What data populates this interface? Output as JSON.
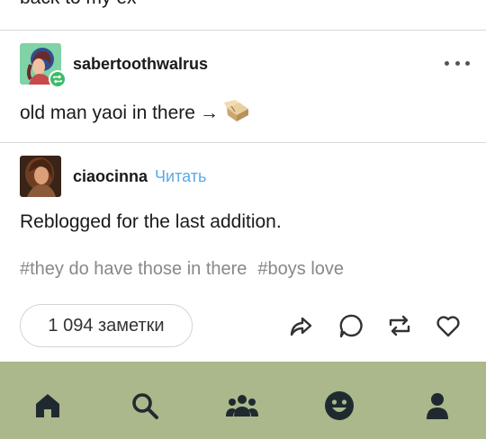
{
  "previous_post": {
    "text": "back to my ex"
  },
  "post1": {
    "username": "sabertoothwalrus",
    "body": "old man yaoi in there",
    "arrow": "→",
    "emoji_icon": "box-emoji-icon"
  },
  "post2": {
    "username": "ciaocinna",
    "follow_label": "Читать",
    "body": "Reblogged for the last addition.",
    "tags": [
      "#they do have those in there",
      "#boys love"
    ]
  },
  "footer": {
    "notes_label": "1 094 заметки"
  },
  "colors": {
    "bottom_bar": "#aab88b",
    "follow": "#5aa9e6",
    "reblog_badge": "#3dbb6b",
    "tag_text": "#888888"
  },
  "icons": {
    "actions": [
      "share-icon",
      "reply-icon",
      "reblog-icon",
      "like-icon"
    ],
    "nav": [
      "home-icon",
      "search-icon",
      "community-icon",
      "activity-icon",
      "account-icon"
    ]
  }
}
